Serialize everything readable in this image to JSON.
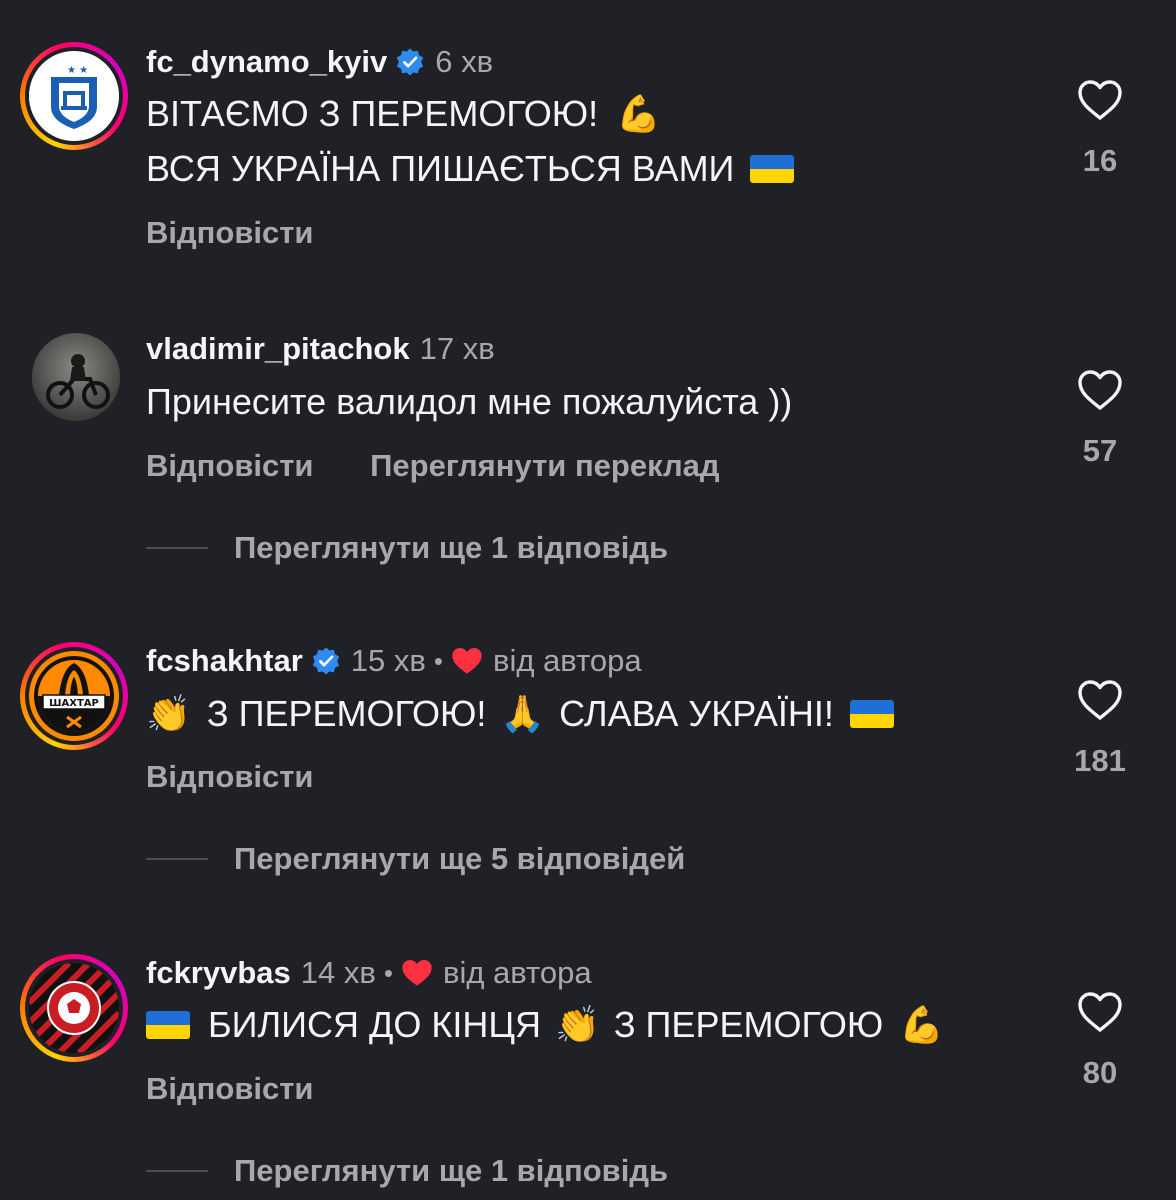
{
  "comments": [
    {
      "username": "fc_dynamo_kyiv",
      "verified": true,
      "time": "6 хв",
      "liked_by_author": false,
      "text_lines": [
        "ВІТАЄМО З ПЕРЕМОГОЮ!",
        "ВСЯ УКРАЇНА ПИШАЄТЬСЯ ВАМИ"
      ],
      "reply_label": "Відповісти",
      "likes": "16"
    },
    {
      "username": "vladimir_pitachok",
      "verified": false,
      "time": "17 хв",
      "liked_by_author": false,
      "text_lines": [
        "Принесите валидол мне пожалуйста ))"
      ],
      "reply_label": "Відповісти",
      "translate_label": "Переглянути переклад",
      "more_replies": "Переглянути ще 1 відповідь",
      "likes": "57"
    },
    {
      "username": "fcshakhtar",
      "verified": true,
      "time": "15 хв",
      "liked_by_author": true,
      "author_label": "від автора",
      "text_segments": [
        "З ПЕРЕМОГОЮ!",
        "СЛАВА УКРАЇНІ!"
      ],
      "reply_label": "Відповісти",
      "more_replies": "Переглянути ще 5 відповідей",
      "likes": "181"
    },
    {
      "username": "fckryvbas",
      "verified": false,
      "time": "14 хв",
      "liked_by_author": true,
      "author_label": "від автора",
      "text_segments": [
        "БИЛИСЯ ДО КІНЦЯ",
        "З ПЕРЕМОГОЮ"
      ],
      "reply_label": "Відповісти",
      "more_replies": "Переглянути ще 1 відповідь",
      "likes": "80"
    }
  ],
  "colors": {
    "background": "#1f2127",
    "text_primary": "#f5f5f5",
    "text_secondary": "#a8a8a8",
    "verified_blue": "#2e8cf0",
    "heart_red": "#ff3040"
  },
  "icons": {
    "verified": "verified-badge-icon",
    "like": "heart-outline-icon",
    "author_like": "heart-filled-icon",
    "emoji_muscle": "💪",
    "emoji_clap": "👏",
    "emoji_pray": "🙏",
    "flag": "ukraine-flag-icon"
  }
}
